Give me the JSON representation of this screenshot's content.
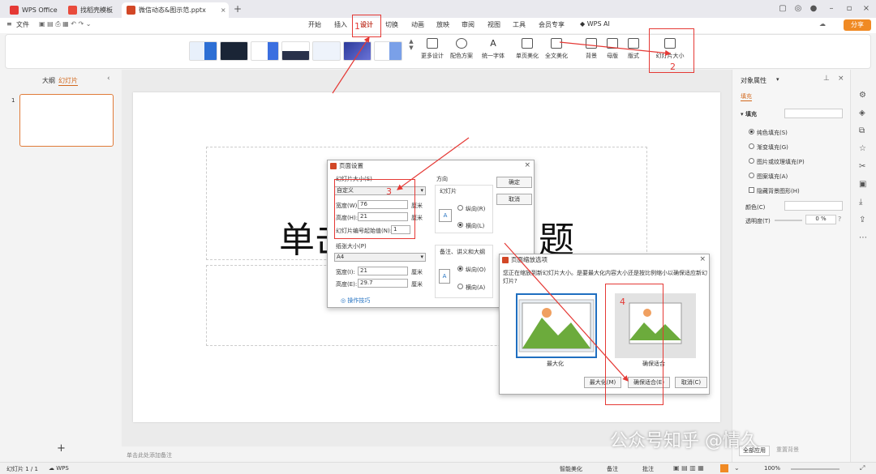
{
  "titlebar": {
    "tabs": [
      {
        "label": "WPS Office"
      },
      {
        "label": "找稻壳模板"
      },
      {
        "label": "微信动态&图示范.pptx"
      }
    ],
    "add_tab": "+"
  },
  "menubar": {
    "file": "文件",
    "items": [
      "开始",
      "插入",
      "设计",
      "切换",
      "动画",
      "放映",
      "审阅",
      "视图",
      "工具",
      "会员专享"
    ],
    "wps_ai": "WPS AI",
    "share": "分享"
  },
  "ribbon": {
    "buttons": [
      "更多设计",
      "配色方案",
      "统一字体",
      "单页美化",
      "全文美化",
      "背景",
      "母版",
      "版式",
      "幻灯片大小"
    ]
  },
  "leftpanel": {
    "tab_outline": "大纲",
    "tab_slides": "幻灯片",
    "slide_number": "1",
    "add": "+"
  },
  "slide": {
    "title_left": "单击",
    "title_right": "题"
  },
  "notes_placeholder": "单击此处添加备注",
  "rightpanel": {
    "title": "对象属性",
    "tab_fill": "填充",
    "section_fill": "填充",
    "options": [
      "纯色填充(S)",
      "渐变填充(G)",
      "图片或纹理填充(P)",
      "图案填充(A)"
    ],
    "hide_bg": "隐藏背景图形(H)",
    "color_label": "颜色(C)",
    "transparency_label": "透明度(T)",
    "transparency_value": "0",
    "transparency_unit": "%",
    "apply_all": "全部应用",
    "reset_bg": "重置背景"
  },
  "page_setup": {
    "title": "页面设置",
    "slide_size_label": "幻灯片大小(S)",
    "slide_size_value": "自定义",
    "width_label": "宽度(W):",
    "width_value": "76",
    "height_label": "高度(H):",
    "height_value": "21",
    "unit": "厘米",
    "start_num_label": "幻灯片编号起始值(N):",
    "start_num_value": "1",
    "paper_label": "纸张大小(P)",
    "paper_value": "A4",
    "paper_width_label": "宽度(I):",
    "paper_width_value": "21",
    "paper_height_label": "高度(E):",
    "paper_height_value": "29.7",
    "orientation_label": "方向",
    "slides_label": "幻灯片",
    "portrait": "纵向(R)",
    "landscape": "横向(L)",
    "notes_label": "备注、讲义和大纲",
    "notes_portrait": "纵向(O)",
    "notes_landscape": "横向(A)",
    "ok": "确定",
    "cancel": "取消",
    "tips": "操作技巧"
  },
  "scale_dialog": {
    "title": "页面缩放选项",
    "message": "您正在缩放到新幻灯片大小。是要最大化内容大小还是按比例缩小以确保适应新幻灯片?",
    "option_max": "最大化",
    "option_fit": "确保适合",
    "btn_max": "最大化(M)",
    "btn_fit": "确保适合(E)",
    "btn_cancel": "取消(C)"
  },
  "annotations": [
    "1",
    "2",
    "3",
    "4"
  ],
  "statusbar": {
    "slide_info": "幻灯片 1 / 1",
    "wps": "WPS",
    "smart": "智能美化",
    "notes": "备注",
    "comments": "批注",
    "zoom": "100%"
  },
  "watermark": "公众号知乎 @情久",
  "colors": {
    "accent_red": "#e53935",
    "wps_orange": "#d24726",
    "dialog_blue": "#1f6fc0"
  }
}
